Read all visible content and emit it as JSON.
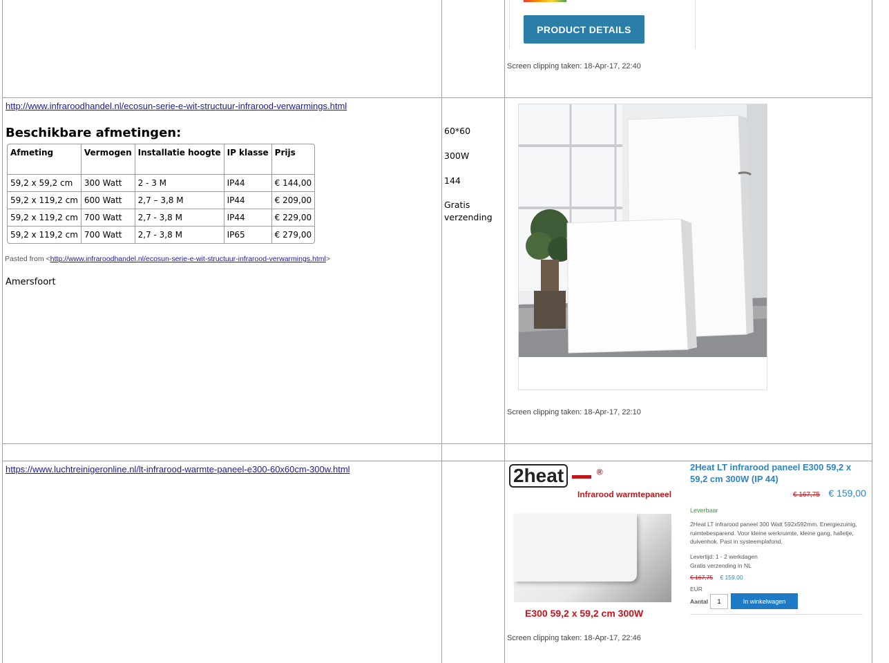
{
  "row1": {
    "product_details_button": "PRODUCT DETAILS",
    "clip_caption": "Screen clipping taken: 18-Apr-17, 22:40"
  },
  "row2": {
    "url": "http://www.infraroodhandel.nl/ecosun-serie-e-wit-structuur-infrarood-verwarmings.html",
    "heading": "Beschikbare afmetingen:",
    "table": {
      "headers": [
        "Afmeting",
        "Vermogen",
        "Installatie hoogte",
        "IP klasse",
        "Prijs"
      ],
      "rows": [
        [
          "59,2 x 59,2 cm",
          "300 Watt",
          "2 - 3 M",
          "IP44",
          "€ 144,00"
        ],
        [
          "59,2 x 119,2 cm",
          "600 Watt",
          "2,7 – 3,8 M",
          "IP44",
          "€ 209,00"
        ],
        [
          "59,2 x 119,2 cm",
          "700 Watt",
          "2,7 - 3,8 M",
          "IP44",
          "€ 229,00"
        ],
        [
          "59,2 x 119,2 cm",
          "700 Watt",
          "2,7 - 3,8 M",
          "IP65",
          "€ 279,00"
        ]
      ]
    },
    "pasted_prefix": "Pasted from <",
    "pasted_url": "http://www.infraroodhandel.nl/ecosun-serie-e-wit-structuur-infrarood-verwarmings.html",
    "pasted_suffix": ">",
    "city": "Amersfoort",
    "spec_size": "60*60",
    "spec_power": "300W",
    "spec_price": "144",
    "spec_shipping": "Gratis verzending",
    "clip_caption": "Screen clipping taken: 18-Apr-17, 22:10"
  },
  "row3": {
    "url": "https://www.luchtreinigeronline.nl/lt-infrarood-warmte-paneel-e300-60x60cm-300w.html",
    "logo_text": "2heat",
    "logo_mark": "®",
    "logo_sub": "Infrarood warmtepaneel",
    "image_caption": "E300 59,2 x 59,2 cm 300W",
    "product_title": "2Heat LT infrarood paneel E300 59,2 x 59,2 cm 300W (IP 44)",
    "old_price": "€ 167,75",
    "new_price": "€ 159,00",
    "availability": "Leverbaar",
    "description": "2Heat LT infrarood paneel 300 Watt 592x592mm. Energiezuinig, ruimtebesparend. Voor kleine werkruimte, kleine gang, halletje, duivenhok. Past in systeemplafond.",
    "delivery": "Levertijd: 1 - 2 werkdagen",
    "shipping": "Gratis verzending in NL",
    "old_price_small": "€ 167,75",
    "new_price_small": "€ 159,00",
    "currency": "EUR",
    "qty_label": "Aantal",
    "qty_value": "1",
    "cart_button": "In winkelwagen",
    "clip_caption": "Screen clipping taken: 18-Apr-17, 22:46"
  },
  "colors": {
    "link": "#1a1aa6",
    "button_blue": "#2a7ea8",
    "brand_red": "#c0161d",
    "shop_blue": "#2a86c8"
  }
}
